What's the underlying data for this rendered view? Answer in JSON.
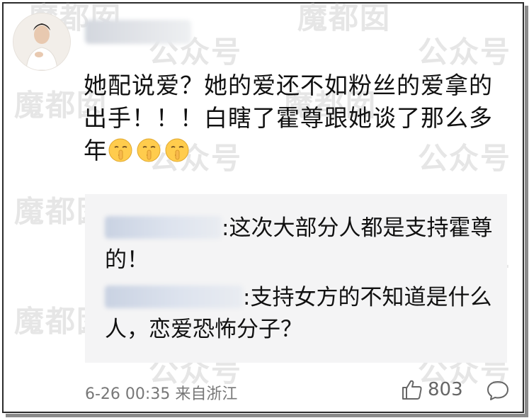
{
  "comment": {
    "text": "她配说爱？她的爱还不如粉丝的爱拿的出手！！！白瞎了霍尊跟她谈了那么多年",
    "emoji": [
      "shushing-face-emoji",
      "shushing-face-emoji",
      "shushing-face-emoji"
    ]
  },
  "replies": [
    {
      "text": ":这次大部分人都是支持霍尊的！"
    },
    {
      "text": ":支持女方的不知道是什么人，恋爱恐怖分子？"
    }
  ],
  "footer": {
    "time_location": "6-26 00:35 来自浙江",
    "likes": "803"
  },
  "watermark": {
    "text_a": "魔都囡",
    "text_b": "公众号"
  },
  "colors": {
    "reply_bg": "#f4f4f5",
    "text": "#111111",
    "meta": "#777777"
  }
}
